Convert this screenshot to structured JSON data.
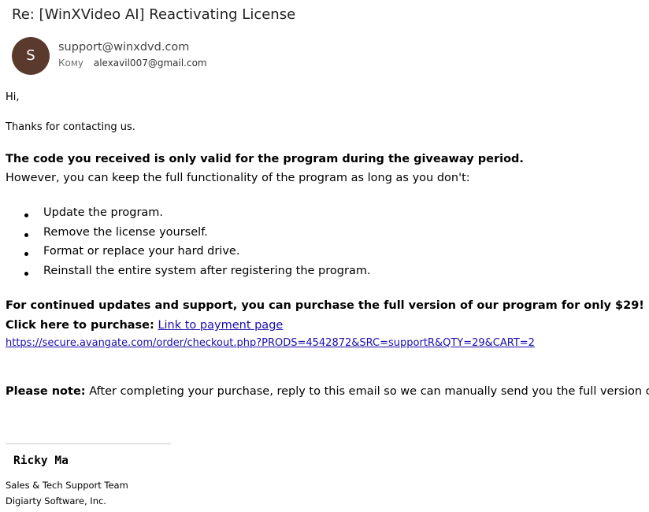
{
  "email": {
    "subject": "Re: [WinXVideo AI] Reactivating License",
    "avatar_letter": "S",
    "sender": "support@winxdvd.com",
    "to_label": "Кому",
    "to_address": "alexavil007@gmail.com"
  },
  "body": {
    "greeting": "Hi,",
    "thanks": "Thanks for contacting us.",
    "code_notice": "The code you received is only valid for the program during the giveaway period.",
    "however": "However, you can keep the full functionality of the program as long as you don't:",
    "bullets": [
      "Update the program.",
      "Remove the license yourself.",
      "Format or replace your hard drive.",
      "Reinstall the entire system after registering the program."
    ],
    "offer": "For continued updates and support, you can purchase the full version of our program for only $29!",
    "purchase_label": "Click here to purchase:",
    "purchase_link_text": "Link to payment page",
    "purchase_url": "https://secure.avangate.com/order/checkout.php?PRODS=4542872&SRC=supportR&QTY=29&CART=2",
    "note_label": "Please note:",
    "note_text": "After completing your purchase, reply to this email so we can manually send you the full version code."
  },
  "signature": {
    "name": "Ricky Ma",
    "team": "Sales & Tech Support Team",
    "company": "Digiarty Software, Inc."
  },
  "colors": {
    "avatar": "#5b3a2e",
    "link": "#1a0dab"
  }
}
